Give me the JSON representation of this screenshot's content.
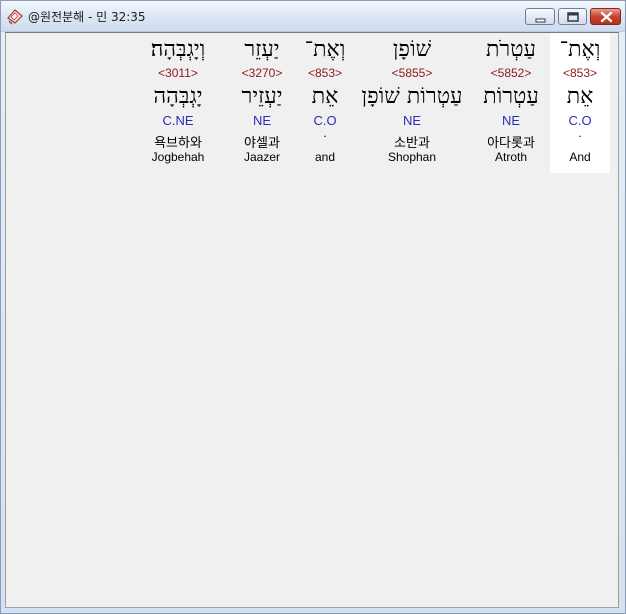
{
  "window": {
    "title": "@원전분해 - 민 32:35",
    "icons": {
      "app": "bible-book-icon",
      "minimize": "minimize-icon",
      "maximize": "maximize-icon",
      "close": "close-icon"
    },
    "colors": {
      "strong_number": "#8b1a1a",
      "part_of_speech": "#2c2cb8",
      "selected_bg": "#ffffff",
      "content_bg": "#f0f0f0"
    }
  },
  "words": [
    {
      "hebrew": "וְאֶת־",
      "strong": "<853>",
      "lemma": "אֵת",
      "pos": "C.O",
      "dot": ".",
      "korean": "",
      "english": "And",
      "selected": true
    },
    {
      "hebrew": "עַטְרֹת",
      "strong": "<5852>",
      "lemma": "עַטְרוֹת",
      "pos": "NE",
      "dot": "",
      "korean": "아다롯과",
      "english": "Atroth",
      "selected": false
    },
    {
      "hebrew": "שׁוֹפָן",
      "strong": "<5855>",
      "lemma": "עַטְרוֹת שׁוֹפָן",
      "pos": "NE",
      "dot": "",
      "korean": "소반과",
      "english": "Shophan",
      "selected": false
    },
    {
      "hebrew": "וְאֶת־",
      "strong": "<853>",
      "lemma": "אֵת",
      "pos": "C.O",
      "dot": ".",
      "korean": "",
      "english": "and",
      "selected": false
    },
    {
      "hebrew": "יַעְזֵר",
      "strong": "<3270>",
      "lemma": "יַעְזֵיר",
      "pos": "NE",
      "dot": "",
      "korean": "야셀과",
      "english": "Jaazer",
      "selected": false
    },
    {
      "hebrew": "וְיָגְבְּהָה׃",
      "strong": "<3011>",
      "lemma": "יָגְבְּהָה",
      "pos": "C.NE",
      "dot": "",
      "korean": "욕브하와",
      "english": "Jogbehah",
      "selected": false
    }
  ]
}
